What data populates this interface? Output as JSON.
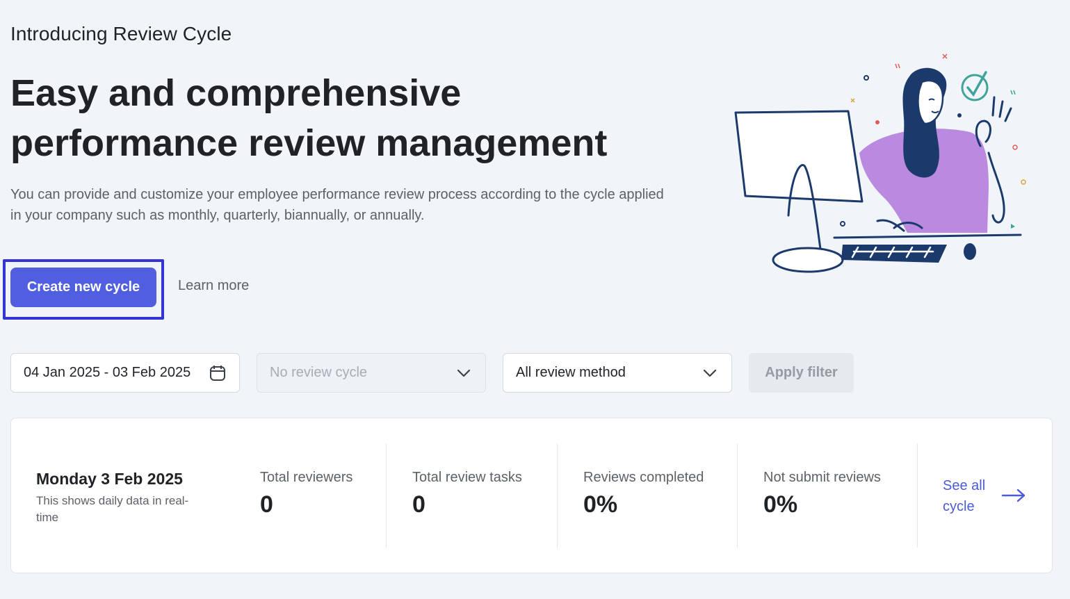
{
  "header": {
    "eyebrow": "Introducing Review Cycle",
    "headline": "Easy and comprehensive performance review management",
    "description": "You can provide and customize your employee performance review process according to the cycle applied in your company such as monthly, quarterly, biannually, or annually."
  },
  "actions": {
    "create_label": "Create new cycle",
    "learn_more_label": "Learn more"
  },
  "filters": {
    "date_range": "04 Jan 2025 - 03 Feb 2025",
    "review_cycle_placeholder": "No review cycle",
    "review_method": "All review method",
    "apply_label": "Apply filter"
  },
  "summary": {
    "date_title": "Monday 3 Feb 2025",
    "date_subtitle": "This shows daily data in real-time",
    "stats": [
      {
        "label": "Total reviewers",
        "value": "0"
      },
      {
        "label": "Total review tasks",
        "value": "0"
      },
      {
        "label": "Reviews completed",
        "value": "0%"
      },
      {
        "label": "Not submit reviews",
        "value": "0%"
      }
    ],
    "see_all_label": "See all cycle"
  },
  "colors": {
    "primary": "#4f5fe0",
    "highlight_outline": "#3434d6",
    "link": "#4a5bd6",
    "illustration_navy": "#1b3a6b",
    "illustration_purple": "#b98ae0",
    "illustration_teal": "#3fa39a"
  },
  "icons": {
    "date_field": "calendar-icon",
    "cycle_field": "chevron-down-icon",
    "method_field": "chevron-down-icon",
    "see_all": "arrow-right-icon"
  }
}
